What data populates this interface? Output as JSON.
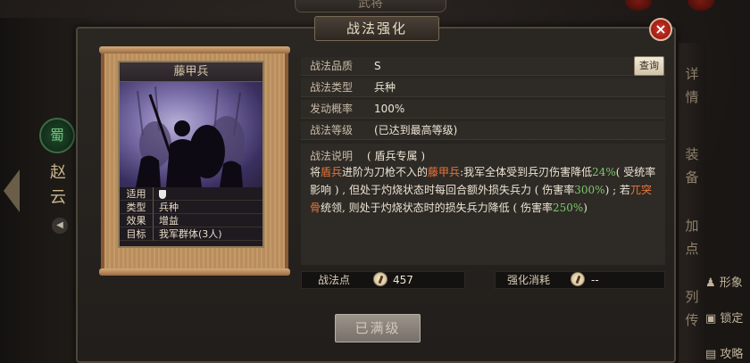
{
  "background": {
    "top_title": "武将",
    "shu_badge": "蜀",
    "hero_name": "赵云",
    "right_tabs": [
      "详情",
      "装备",
      "加点",
      "列传"
    ],
    "right_items": [
      "形象",
      "锁定",
      "攻略"
    ]
  },
  "dialog": {
    "title": "战法强化",
    "close": "×"
  },
  "card": {
    "name": "藤甲兵",
    "stats": [
      {
        "key": "适用",
        "value": ""
      },
      {
        "key": "类型",
        "value": "兵种"
      },
      {
        "key": "效果",
        "value": "增益"
      },
      {
        "key": "目标",
        "value": "我军群体(3人)"
      }
    ]
  },
  "info": {
    "quality_label": "战法品质",
    "quality_value": "S",
    "search_button": "查询",
    "type_label": "战法类型",
    "type_value": "兵种",
    "rate_label": "发动概率",
    "rate_value": "100%",
    "level_label": "战法等级",
    "level_value": "(已达到最高等级)",
    "desc_label": "战法说明",
    "desc_tag": "( 盾兵专属 )",
    "desc_parts": [
      {
        "t": "将",
        "c": ""
      },
      {
        "t": "盾兵",
        "c": "orange"
      },
      {
        "t": "进阶为刀枪不入的",
        "c": ""
      },
      {
        "t": "藤甲兵",
        "c": "orange"
      },
      {
        "t": ":我军全体受到兵刃伤害降低",
        "c": ""
      },
      {
        "t": "24%",
        "c": "green"
      },
      {
        "t": "( 受统率影响 ) , 但处于灼烧状态时每回合额外损失兵力 ( 伤害率",
        "c": ""
      },
      {
        "t": "300%",
        "c": "green"
      },
      {
        "t": ") ; 若",
        "c": ""
      },
      {
        "t": "兀突骨",
        "c": "orange"
      },
      {
        "t": "统领, 则处于灼烧状态时的损失兵力降低 ( 伤害率",
        "c": ""
      },
      {
        "t": "250%",
        "c": "green"
      },
      {
        "t": ")",
        "c": ""
      }
    ]
  },
  "bottom": {
    "points_label": "战法点",
    "points_value": "457",
    "cost_label": "强化消耗",
    "cost_value": "--",
    "maxed_button": "已满级"
  },
  "colors": {
    "highlight_orange": "#e8763a",
    "highlight_green": "#7cc86a",
    "close_red": "#c82a20"
  },
  "icons": [
    "close-icon",
    "shield-icon",
    "coin-icon",
    "sound-icon",
    "arrow-left-icon"
  ]
}
